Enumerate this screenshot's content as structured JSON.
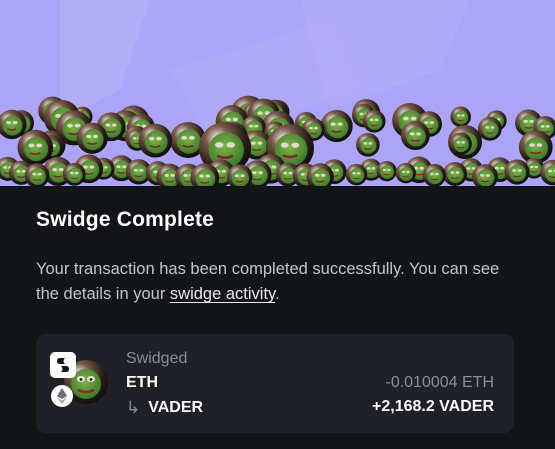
{
  "modal": {
    "title": "Swidge Complete",
    "description_prefix": "Your transaction has been completed successfully. You can see the details in your ",
    "link_text": "swidge activity",
    "description_suffix": "."
  },
  "card": {
    "status_label": "Swidged",
    "from_token": "ETH",
    "to_token": "VADER",
    "arrow_icon": "return-arrow-icon",
    "from_amount": "-0.010004 ETH",
    "to_amount": "+2,168.2 VADER"
  },
  "icons": {
    "hero": "pepe-coins-illustration",
    "app_badge": "app-logo-icon",
    "token_badge": "pepe-token-icon",
    "chain_badge": "ethereum-icon"
  },
  "colors": {
    "hero_background": "#aba4f7",
    "page_background": "#131418",
    "card_background": "#1f2126",
    "muted_text": "#8a8d96"
  }
}
